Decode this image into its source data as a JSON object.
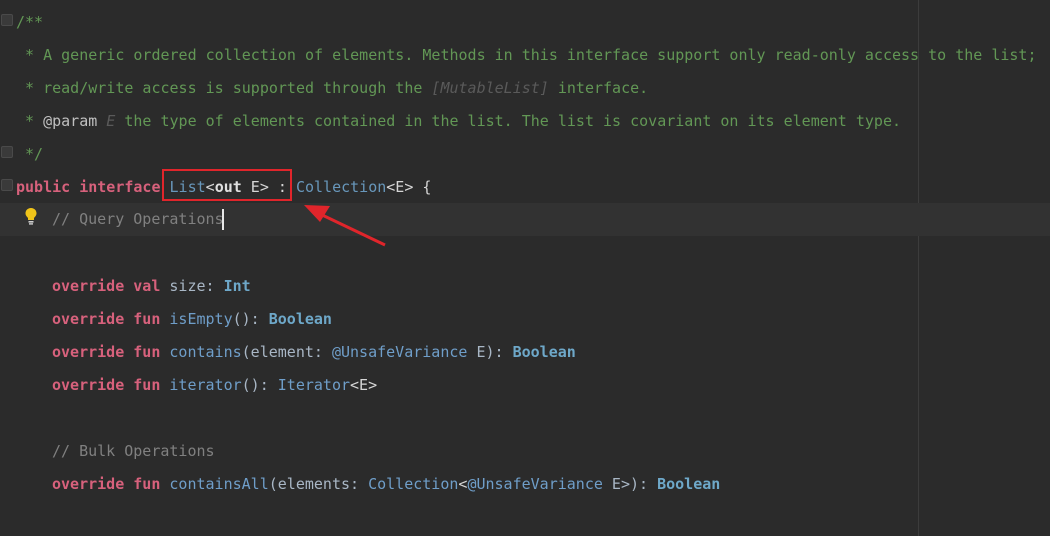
{
  "editor": {
    "doc": {
      "open": "/**",
      "line1": " * A generic ordered collection of elements. Methods in this interface support only read-only access to the list;",
      "line2_pre": " * read/write access is supported through the ",
      "line2_ref": "[MutableList]",
      "line2_post": " interface.",
      "line3_star": " * ",
      "line3_tag": "@param",
      "line3_name": " E ",
      "line3_text": "the type of elements contained in the list. The list is covariant on its element type.",
      "close": " */"
    },
    "declaration": {
      "kw_public": "public",
      "kw_interface": "interface",
      "name": "List",
      "lt": "<",
      "kw_out": "out",
      "type_param": " E",
      "gt": ">",
      "colon": " : ",
      "super": "Collection",
      "super_generic": "<E>",
      "brace": " {"
    },
    "comment_query": "// Query Operations",
    "size_line": {
      "override": "override",
      "val": "val",
      "name": " size: ",
      "type": "Int"
    },
    "isEmpty_line": {
      "override": "override",
      "fun": "fun",
      "name": "isEmpty",
      "sig": "(): ",
      "type": "Boolean"
    },
    "contains_line": {
      "override": "override",
      "fun": "fun",
      "name": "contains",
      "sig1": "(element: ",
      "anno": "@UnsafeVariance",
      "sig2": " E): ",
      "type": "Boolean"
    },
    "iterator_line": {
      "override": "override",
      "fun": "fun",
      "name": "iterator",
      "sig": "(): ",
      "type": "Iterator",
      "generic": "<E>"
    },
    "comment_bulk": "// Bulk Operations",
    "containsAll_line": {
      "override": "override",
      "fun": "fun",
      "name": "containsAll",
      "sig1": "(elements: ",
      "type1": "Collection",
      "lt": "<",
      "anno": "@UnsafeVariance",
      "sig2": " E>): ",
      "type": "Boolean"
    }
  },
  "colors": {
    "background": "#2b2b2b",
    "current_line": "#323232",
    "annotation_box": "#e0252b",
    "arrow": "#e0252b"
  }
}
